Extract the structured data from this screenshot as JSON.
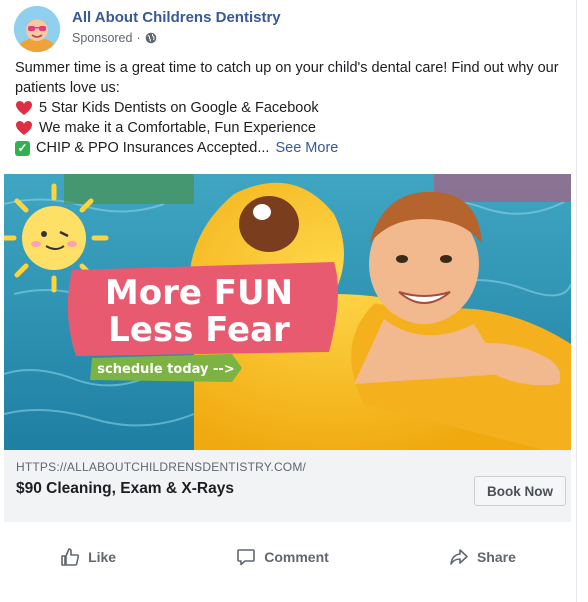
{
  "page": {
    "name": "All About Childrens Dentistry",
    "sponsored": "Sponsored"
  },
  "post": {
    "intro": "Summer time is a great time to catch up on your child's dental care! Find out why our patients love us:",
    "bullets": [
      {
        "icon": "heart-icon",
        "text": "5 Star Kids Dentists on Google & Facebook"
      },
      {
        "icon": "heart-icon",
        "text": "We make it a Comfortable, Fun Experience"
      },
      {
        "icon": "check-icon",
        "text": "CHIP & PPO Insurances Accepted...",
        "more": "See More"
      }
    ]
  },
  "ad": {
    "headline_line1": "More FUN",
    "headline_line2": "Less Fear",
    "tagline": "schedule today -->"
  },
  "link": {
    "url": "HTTPS://ALLABOUTCHILDRENSDENTISTRY.COM/",
    "title": "$90 Cleaning, Exam & X-Rays",
    "cta": "Book Now"
  },
  "actions": {
    "like": "Like",
    "comment": "Comment",
    "share": "Share"
  },
  "colors": {
    "link_blue": "#385898",
    "pink_banner": "#e85a6f",
    "green_tag": "#7cb342",
    "duck_yellow": "#f9c21b",
    "pool_blue": "#2b9ab8"
  }
}
